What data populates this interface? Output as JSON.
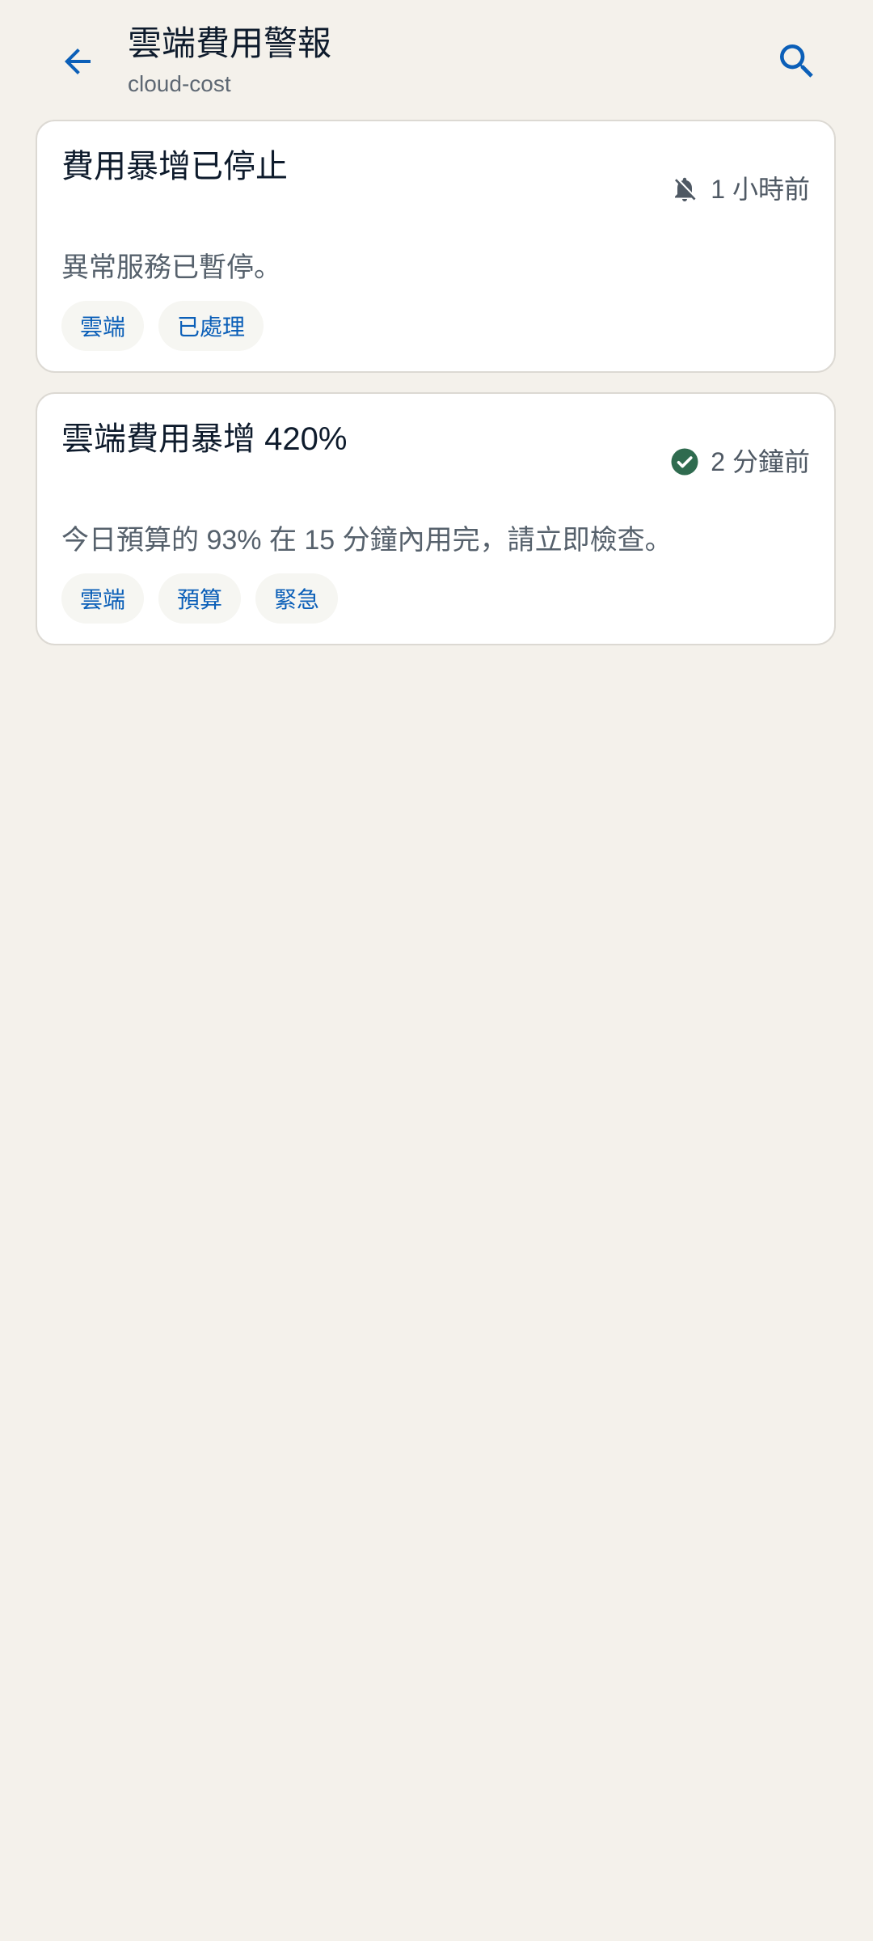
{
  "header": {
    "title": "雲端費用警報",
    "subtitle": "cloud-cost",
    "back_icon": "arrow-back-icon",
    "search_icon": "search-icon"
  },
  "alerts": [
    {
      "title": "費用暴增已停止",
      "time": "1 小時前",
      "status_icon": "bell-off-icon",
      "body": "異常服務已暫停。",
      "tags": [
        "雲端",
        "已處理"
      ]
    },
    {
      "title": "雲端費用暴增 420%",
      "time": "2 分鐘前",
      "status_icon": "check-circle-icon",
      "body": "今日預算的 93% 在 15 分鐘內用完，請立即檢查。",
      "tags": [
        "雲端",
        "預算",
        "緊急"
      ]
    }
  ],
  "colors": {
    "background": "#F4F1EB",
    "accent": "#0B5FB8",
    "success": "#2F6B4F",
    "muted_icon": "#4F5964"
  }
}
